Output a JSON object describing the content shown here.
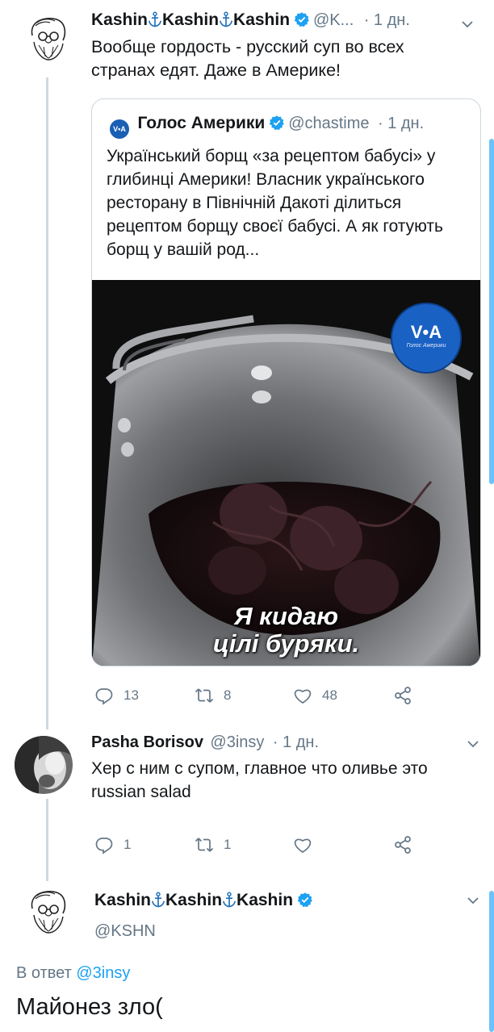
{
  "tweet1": {
    "name": "Kashin⚓Kashin⚓Kashin",
    "name_parts": [
      "Kashin",
      "Kashin",
      "Kashin"
    ],
    "handle": "@K...",
    "time": "· 1 дн.",
    "text": "Вообще гордость - русский суп во всех странах едят. Даже в Америке!",
    "quote": {
      "name": "Голос Америки",
      "handle": "@chastime",
      "time": "· 1 дн.",
      "text": "Український борщ «за рецептом бабусі» у глибинці Америки! Власник українського ресторану в Північній Дакоті ділиться рецептом борщу своєї бабусі. А як готують борщ у вашій род...",
      "logo_text": "V•A",
      "media_logo": "V•A",
      "media_logo_sub": "Голос Америки",
      "caption_line1": "Я кидаю",
      "caption_line2": "цілі буряки."
    },
    "actions": {
      "replies": "13",
      "retweets": "8",
      "likes": "48"
    }
  },
  "tweet2": {
    "name": "Pasha Borisov",
    "handle": "@3insy",
    "time": "· 1 дн.",
    "text": "Хер с ним с супом, главное что оливье это russian salad",
    "actions": {
      "replies": "1",
      "retweets": "1",
      "likes": ""
    }
  },
  "tweet3": {
    "name_parts": [
      "Kashin",
      "Kashin",
      "Kashin"
    ],
    "handle": "@KSHN",
    "reply_prefix": "В ответ",
    "reply_to": "@3insy",
    "text": "Майонез зло("
  },
  "colors": {
    "accent": "#1da1f2",
    "muted": "#657786",
    "line": "#cfd9de"
  },
  "icons": [
    "verified-icon",
    "anchor-icon",
    "chevron-down-icon",
    "reply-icon",
    "retweet-icon",
    "like-icon",
    "share-icon"
  ]
}
